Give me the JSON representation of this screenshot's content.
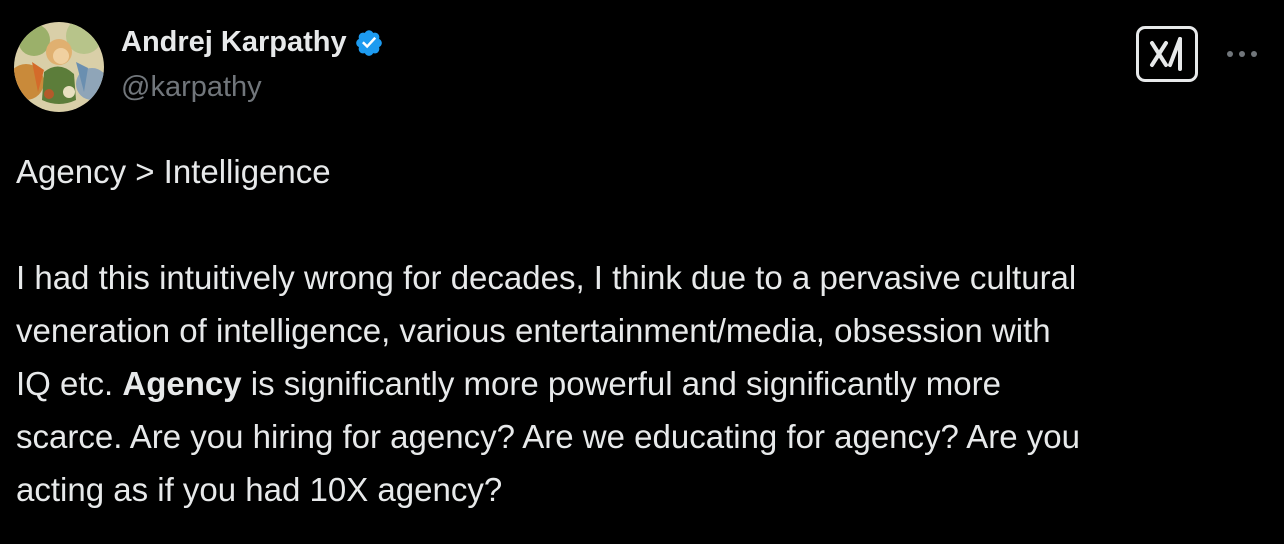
{
  "author": {
    "display_name": "Andrej Karpathy",
    "handle": "@karpathy",
    "verified": true,
    "verified_color": "#1d9bf0"
  },
  "header": {
    "grok_icon": "grok-logo-icon",
    "more_icon": "more-options-icon"
  },
  "tweet": {
    "title_line": "Agency > Intelligence",
    "line1": "I had this intuitively wrong for decades, I think due to a pervasive cultural",
    "line2": "veneration of intelligence, various entertainment/media, obsession with",
    "line3_prefix": "IQ etc. ",
    "line3_bold": "Agency",
    "line3_suffix": " is significantly more powerful and significantly more",
    "line4": "scarce. Are you hiring for agency? Are we educating for agency? Are you",
    "line5": "acting as if you had 10X agency?"
  },
  "colors": {
    "background": "#000000",
    "text": "#e7e9ea",
    "secondary_text": "#71767b"
  }
}
